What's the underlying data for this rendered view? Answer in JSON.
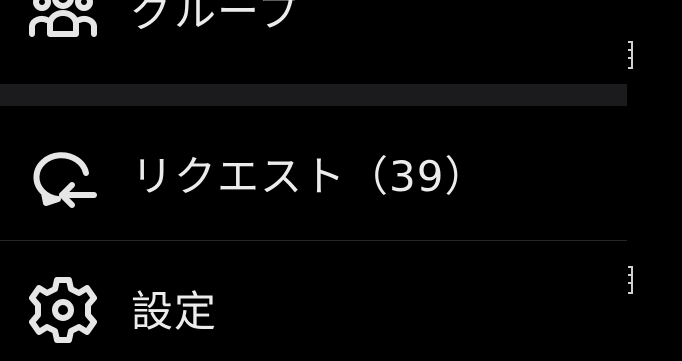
{
  "drawer": {
    "items": [
      {
        "label": "グループ",
        "icon": "group-icon"
      },
      {
        "label": "リクエスト（39）",
        "icon": "message-request-icon"
      },
      {
        "label": "設定",
        "icon": "gear-icon"
      }
    ]
  },
  "colors": {
    "background": "#000000",
    "text": "#ececec",
    "divider_band": "#1b1b1d",
    "divider_line": "#262628",
    "icon": "#e6e6e6"
  }
}
